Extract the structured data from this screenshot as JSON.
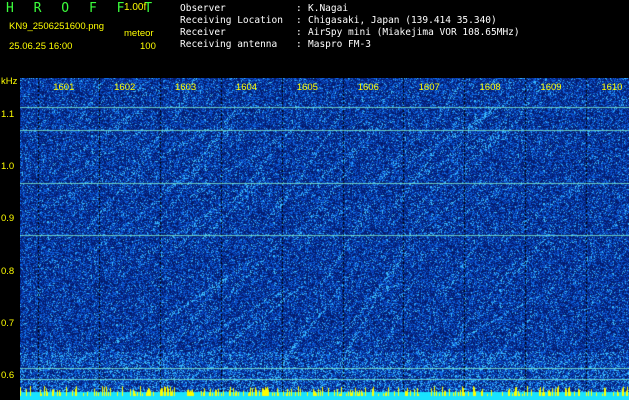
{
  "header": {
    "brand": "H R O F F T",
    "version": "1.00f",
    "filename": "KN9_2506251600.png",
    "datetime": "25.06.25 16:00",
    "meteor_label": "meteor",
    "meteor_value": "100",
    "fields": [
      {
        "label": "Observer",
        "value": "K.Nagai"
      },
      {
        "label": "Receiving Location",
        "value": "Chigasaki, Japan (139.414 35.340)"
      },
      {
        "label": "Receiver",
        "value": "AirSpy mini (Miakejima VOR 108.65MHz)"
      },
      {
        "label": "Receiving antenna",
        "value": "Maspro FM-3"
      }
    ]
  },
  "chart_data": {
    "type": "heatmap",
    "ylabel": "kHz",
    "x_ticks": [
      "1601",
      "1602",
      "1603",
      "1604",
      "1605",
      "1606",
      "1607",
      "1608",
      "1609",
      "1610"
    ],
    "y_ticks": [
      "1.1",
      "1.0",
      "0.9",
      "0.8",
      "0.7",
      "0.6"
    ],
    "y_range": [
      0.57,
      1.17
    ],
    "horizontal_carriers_khz": [
      1.115,
      1.07,
      0.97,
      0.87,
      0.615,
      0.595
    ],
    "colors": {
      "background": "#041a6a",
      "noise_mid": "#0a55c8",
      "noise_high": "#27b3ff",
      "carrier": "#7ef0d0",
      "bottom_band": "#19e3ff",
      "bottom_spikes": "#ffff00",
      "grid": "#000000"
    }
  }
}
